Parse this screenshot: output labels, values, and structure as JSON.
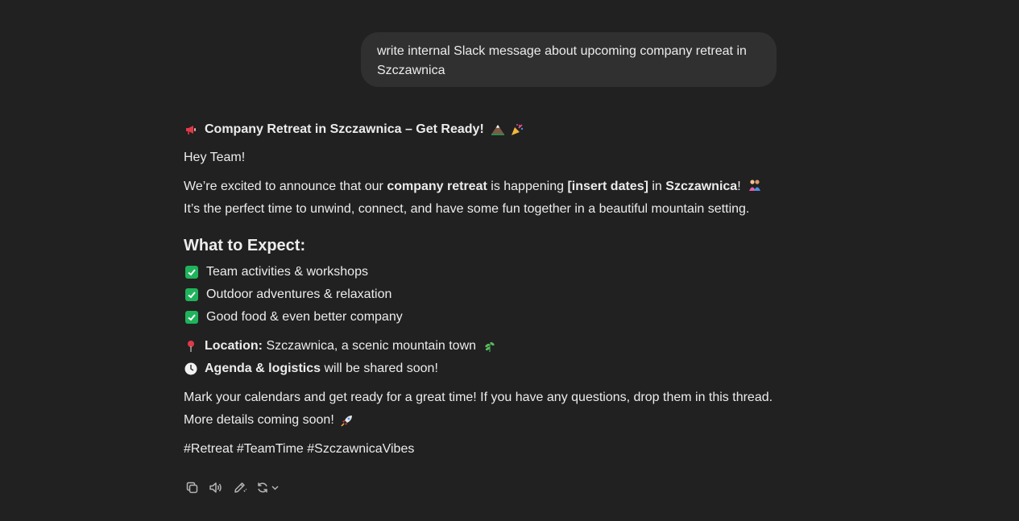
{
  "user_message": "write internal Slack message about upcoming company retreat in Szczawnica",
  "response": {
    "title": "Company Retreat in Szczawnica – Get Ready!",
    "title_icon": "megaphone-icon",
    "title_trailing_icons": [
      "mountain-icon",
      "party-popper-icon"
    ],
    "greeting": "Hey Team!",
    "intro": {
      "part1": "We’re excited to announce that our ",
      "bold1": "company retreat",
      "part2": " is happening ",
      "bold2": "[insert dates]",
      "part3": " in ",
      "bold3": "Szczawnica",
      "part4": "! ",
      "emoji": "hugging-people-icon",
      "part5": " It’s the perfect time to unwind, connect, and have some fun together in a beautiful mountain setting."
    },
    "section_heading": "What to Expect:",
    "checklist": [
      "Team activities & workshops",
      "Outdoor adventures & relaxation",
      "Good food & even better company"
    ],
    "location": {
      "label": "Location:",
      "value": " Szczawnica, a scenic mountain town",
      "icon": "pin-icon",
      "trailing_icon": "herb-icon"
    },
    "agenda": {
      "label": "Agenda & logistics",
      "value": " will be shared soon!",
      "icon": "clock-icon"
    },
    "closing_line1": "Mark your calendars and get ready for a great time! If you have any questions, drop them in this thread.",
    "closing_line2": "More details coming soon!",
    "closing_icon": "rocket-icon",
    "hashtags": "#Retreat #TeamTime #SzczawnicaVibes"
  },
  "actions": [
    "copy-icon",
    "read-aloud-icon",
    "edit-icon",
    "regenerate-icon"
  ],
  "colors": {
    "background": "#212121",
    "user_bubble": "#303030",
    "text": "#ececec",
    "check": "#1fb35b"
  }
}
